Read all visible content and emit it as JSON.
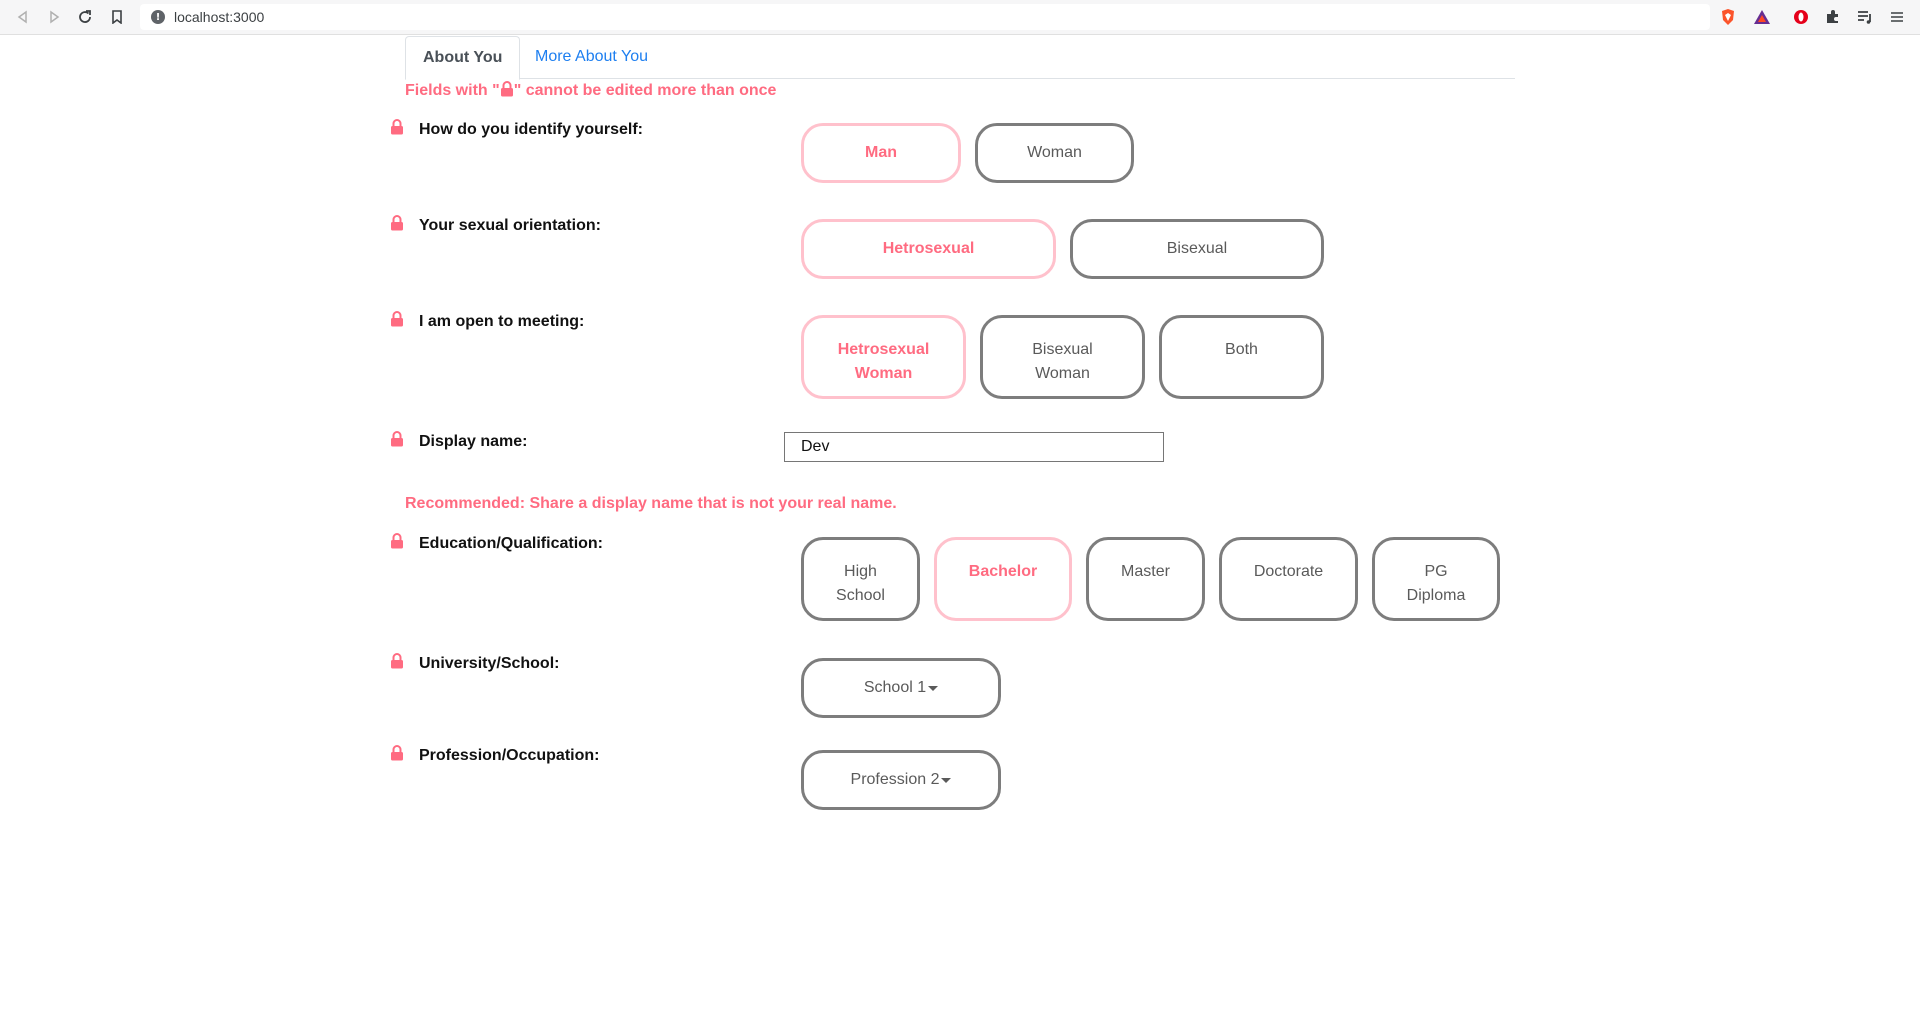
{
  "browser": {
    "url": "localhost:3000",
    "info_glyph": "!"
  },
  "tabs": [
    {
      "label": "About You",
      "active": true
    },
    {
      "label": "More About You",
      "active": false
    }
  ],
  "notice": {
    "prefix": "Fields with \"",
    "suffix": "\" cannot be edited more than once"
  },
  "questions": {
    "identify": {
      "label": "How do you identify yourself:",
      "options": [
        {
          "label": "Man",
          "selected": true
        },
        {
          "label": "Woman",
          "selected": false
        }
      ]
    },
    "orientation": {
      "label": "Your sexual orientation:",
      "options": [
        {
          "label": "Hetrosexual",
          "selected": true
        },
        {
          "label": "Bisexual",
          "selected": false
        }
      ]
    },
    "meeting": {
      "label": "I am open to meeting:",
      "options": [
        {
          "line1": "Hetrosexual",
          "line2": "Woman",
          "selected": true
        },
        {
          "line1": "Bisexual",
          "line2": "Woman",
          "selected": false
        },
        {
          "label": "Both",
          "selected": false
        }
      ]
    },
    "display_name": {
      "label": "Display name:",
      "value": "Dev"
    },
    "education": {
      "label": "Education/Qualification:",
      "options": [
        {
          "line1": "High",
          "line2": "School",
          "selected": false
        },
        {
          "label": "Bachelor",
          "selected": true
        },
        {
          "label": "Master",
          "selected": false
        },
        {
          "label": "Doctorate",
          "selected": false
        },
        {
          "line1": "PG",
          "line2": "Diploma",
          "selected": false
        }
      ]
    },
    "university": {
      "label": "University/School:",
      "selected": "School 1"
    },
    "profession": {
      "label": "Profession/Occupation:",
      "selected": "Profession 2"
    }
  },
  "recommendation": "Recommended: Share a display name that is not your real name.",
  "colors": {
    "accent_pink": "#ff6b81",
    "selected_border": "#ffc1cc",
    "unselected_border": "#7d7d7d",
    "tab_link": "#1e7ff0"
  }
}
